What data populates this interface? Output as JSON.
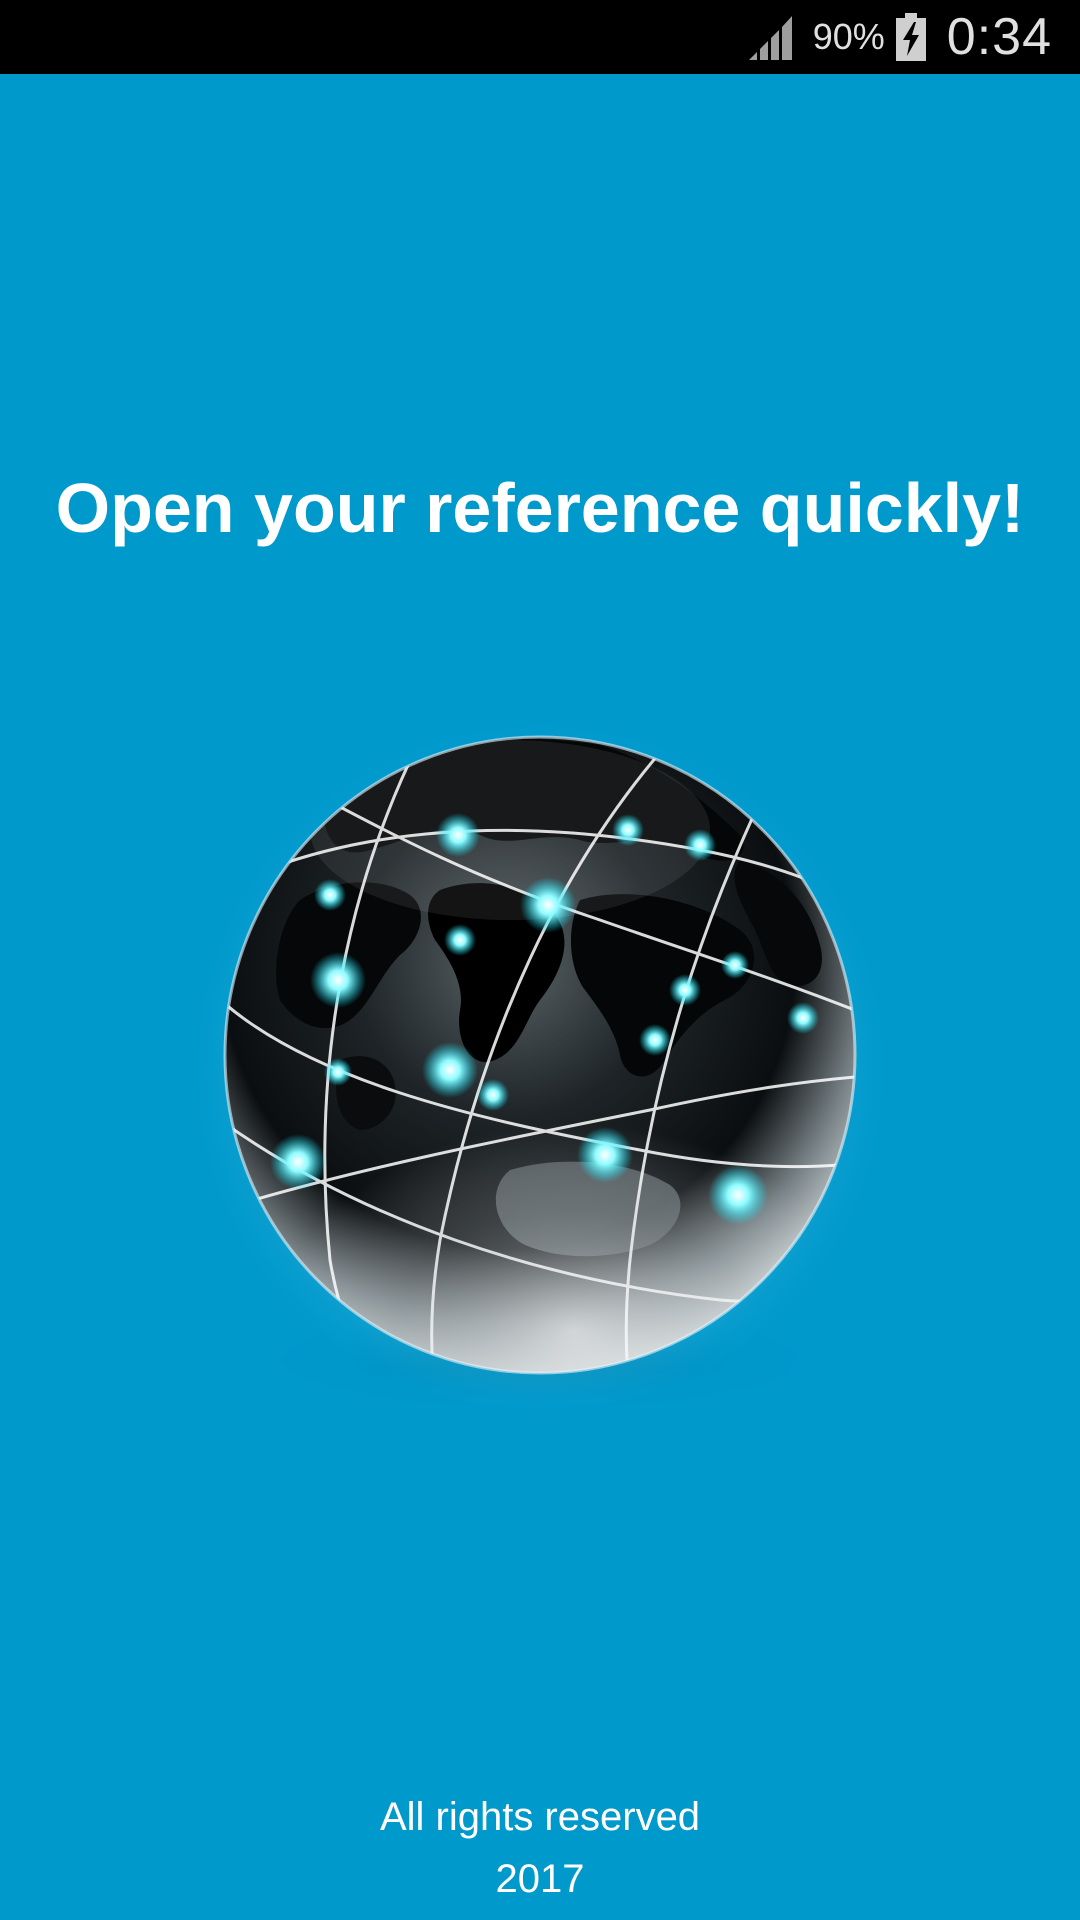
{
  "status_bar": {
    "battery_percent": "90%",
    "time": "0:34",
    "icons": [
      "signal-icon",
      "battery-charging-icon"
    ]
  },
  "splash": {
    "headline": "Open your reference quickly!",
    "image": "globe-network-icon"
  },
  "footer": {
    "line1": "All rights reserved",
    "line2": "2017"
  },
  "colors": {
    "background": "#0099cc",
    "status_bar": "#000000",
    "text": "#ffffff",
    "node_glow": "#4ff4ff"
  }
}
